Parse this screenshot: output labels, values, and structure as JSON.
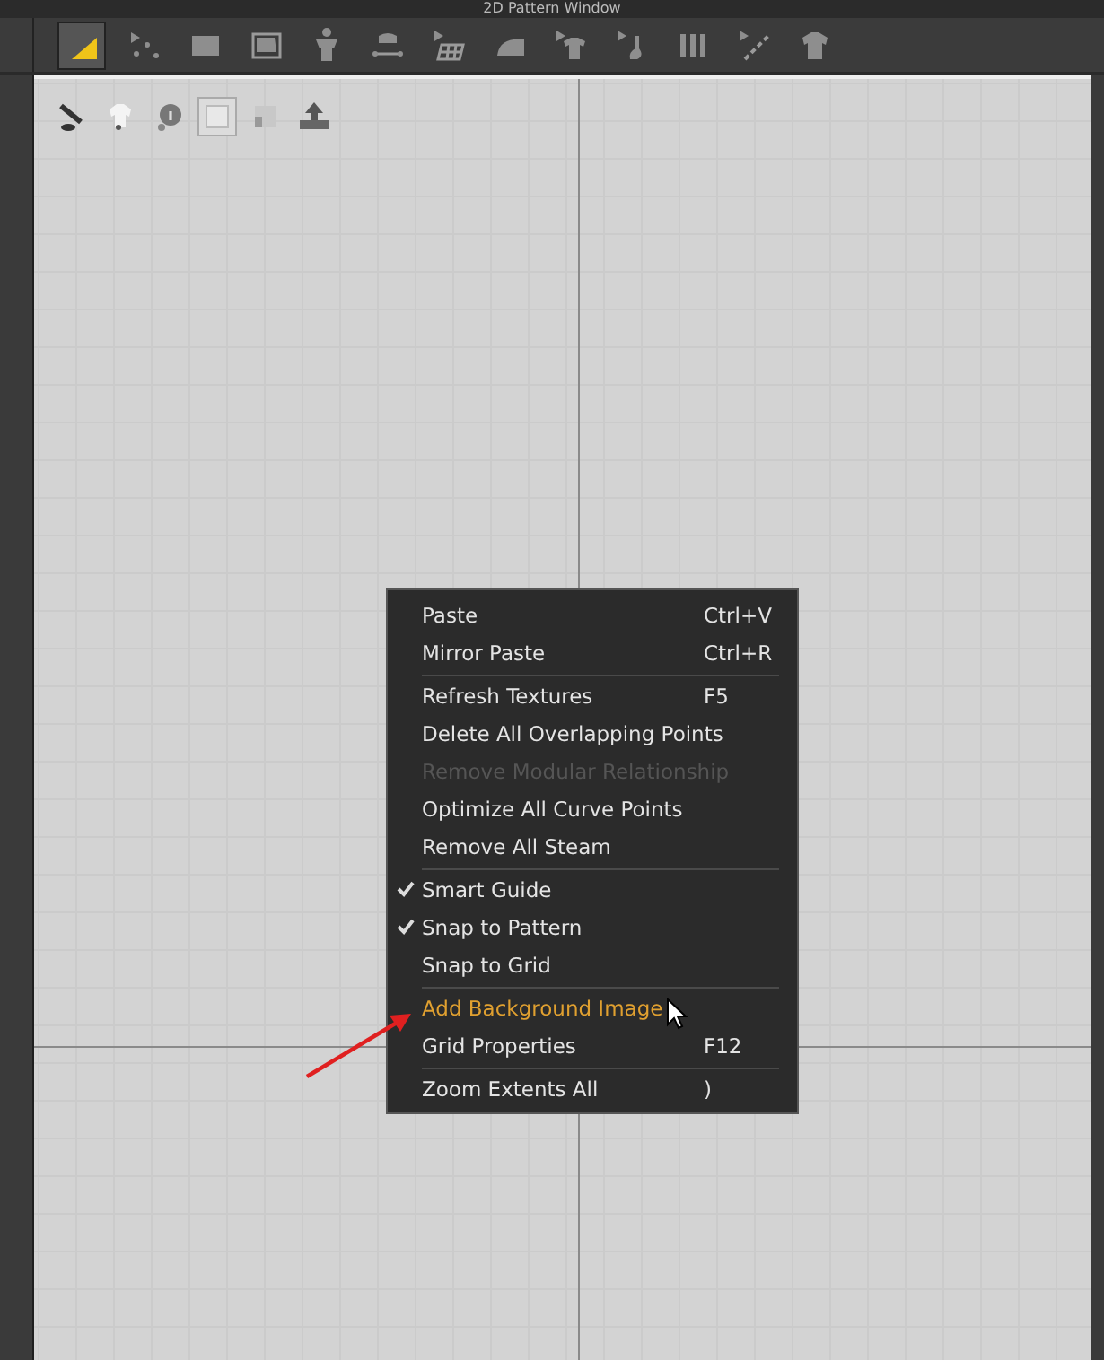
{
  "window": {
    "title": "2D Pattern Window"
  },
  "toolbar": [
    {
      "selected": true
    },
    {
      "selected": false
    },
    {
      "selected": false
    },
    {
      "selected": false
    },
    {
      "selected": false
    },
    {
      "selected": false
    },
    {
      "selected": false
    },
    {
      "selected": false
    },
    {
      "selected": false
    },
    {
      "selected": false
    },
    {
      "selected": false
    },
    {
      "selected": false
    },
    {
      "selected": false
    }
  ],
  "canvas_tools": [
    {
      "selected": false
    },
    {
      "selected": false
    },
    {
      "selected": false
    },
    {
      "selected": true
    },
    {
      "selected": false
    },
    {
      "selected": false
    }
  ],
  "context_menu": {
    "items": [
      {
        "label": "Paste",
        "shortcut": "Ctrl+V",
        "checked": false,
        "disabled": false,
        "hovered": false,
        "separator_after": false
      },
      {
        "label": "Mirror Paste",
        "shortcut": "Ctrl+R",
        "checked": false,
        "disabled": false,
        "hovered": false,
        "separator_after": true
      },
      {
        "label": "Refresh Textures",
        "shortcut": "F5",
        "checked": false,
        "disabled": false,
        "hovered": false,
        "separator_after": false
      },
      {
        "label": "Delete All Overlapping Points",
        "checked": false,
        "disabled": false,
        "hovered": false,
        "separator_after": false
      },
      {
        "label": "Remove Modular Relationship",
        "checked": false,
        "disabled": true,
        "hovered": false,
        "separator_after": false
      },
      {
        "label": "Optimize All Curve Points",
        "checked": false,
        "disabled": false,
        "hovered": false,
        "separator_after": false
      },
      {
        "label": "Remove All Steam",
        "checked": false,
        "disabled": false,
        "hovered": false,
        "separator_after": true
      },
      {
        "label": "Smart Guide",
        "checked": true,
        "disabled": false,
        "hovered": false,
        "separator_after": false
      },
      {
        "label": "Snap to Pattern",
        "checked": true,
        "disabled": false,
        "hovered": false,
        "separator_after": false
      },
      {
        "label": "Snap to Grid",
        "checked": false,
        "disabled": false,
        "hovered": false,
        "separator_after": true
      },
      {
        "label": "Add Background Image",
        "checked": false,
        "disabled": false,
        "hovered": true,
        "separator_after": false
      },
      {
        "label": "Grid Properties",
        "shortcut": "F12",
        "checked": false,
        "disabled": false,
        "hovered": false,
        "separator_after": true
      },
      {
        "label": "Zoom Extents All",
        "shortcut": ")",
        "checked": false,
        "disabled": false,
        "hovered": false,
        "separator_after": false
      }
    ]
  }
}
